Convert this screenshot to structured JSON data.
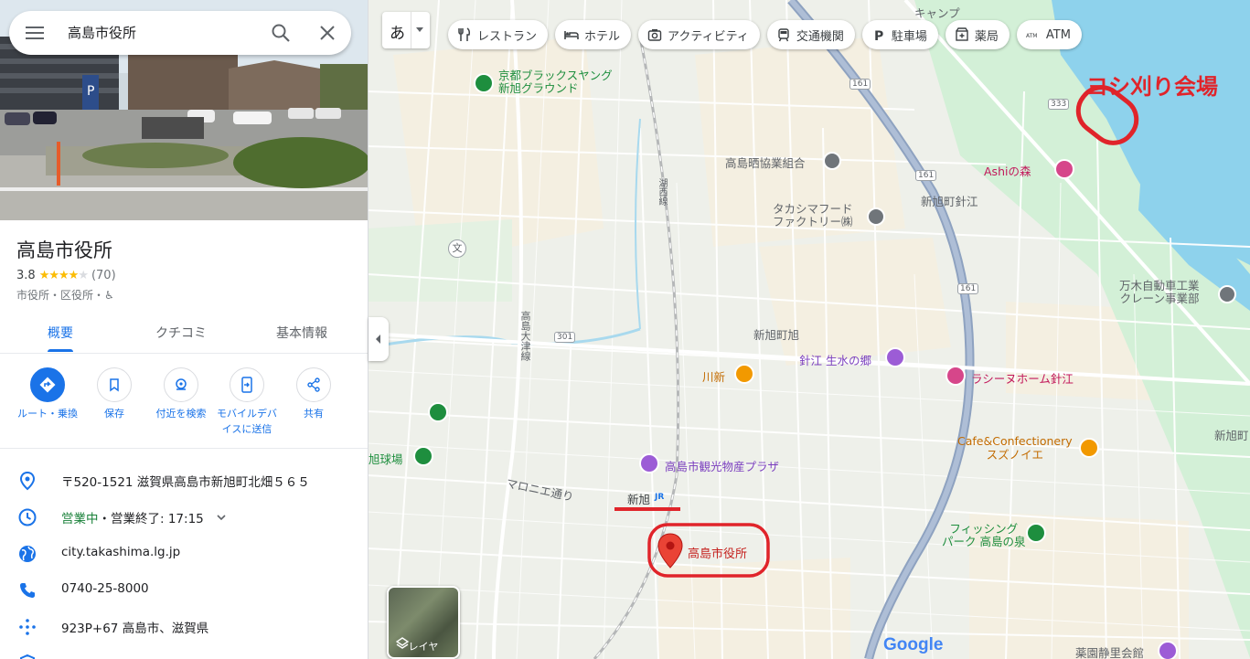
{
  "search": {
    "query": "高島市役所"
  },
  "place": {
    "name": "高島市役所",
    "rating": "3.8",
    "stars": 4,
    "review_count": "(70)",
    "category": "市役所・区役所・♿"
  },
  "tabs": [
    {
      "label": "概要",
      "active": true
    },
    {
      "label": "クチコミ",
      "active": false
    },
    {
      "label": "基本情報",
      "active": false
    }
  ],
  "actions": [
    {
      "label": "ルート・乗換",
      "icon": "directions-icon"
    },
    {
      "label": "保存",
      "icon": "bookmark-icon"
    },
    {
      "label": "付近を検索",
      "icon": "nearby-icon"
    },
    {
      "label": "モバイルデバ",
      "label2": "イスに送信",
      "icon": "send-to-phone-icon"
    },
    {
      "label": "共有",
      "icon": "share-icon"
    }
  ],
  "info": {
    "address": "〒520-1521 滋賀県高島市新旭町北畑５６５",
    "hours_open": "営業中",
    "hours_rest": "・営業終了: 17:15",
    "website": "city.takashima.lg.jp",
    "phone": "0740-25-8000",
    "pluscode": "923P+67 高島市、滋賀県"
  },
  "map": {
    "ime": "あ",
    "chips": [
      {
        "label": "レストラン",
        "icon": "restaurant-icon"
      },
      {
        "label": "ホテル",
        "icon": "hotel-icon"
      },
      {
        "label": "アクティビティ",
        "icon": "camera-icon"
      },
      {
        "label": "交通機関",
        "icon": "transit-icon"
      },
      {
        "label": "駐車場",
        "icon": "parking-icon"
      },
      {
        "label": "薬局",
        "icon": "pharmacy-icon"
      },
      {
        "label": "ATM",
        "icon": "atm-icon"
      }
    ],
    "layer_label": "レイヤ",
    "labels": {
      "kyoto_ground_1": "京都ブラックスヤング",
      "kyoto_ground_2": "新旭グラウンド",
      "sarashi": "高島晒協業組合",
      "takashima_factory_1": "タカシマフード",
      "takashima_factory_2": "ファクトリー㈱",
      "harie_area": "新旭町針江",
      "ashi_no_mori": "Ashiの森",
      "manki_1": "万木自動車工業",
      "manki_2": "クレーン事業部",
      "shinasahi_town": "新旭町旭",
      "shozu": "針江 生水の郷",
      "kawashin": "川新",
      "rashinu": "ラシーヌホーム針江",
      "cafe_1": "Cafe&Confectionery",
      "cafe_2": "スズノイエ",
      "kanko_plaza": "高島市観光物産プラザ",
      "maronie": "マロニエ通り",
      "station": "新旭",
      "cityhall_pin": "高島市役所",
      "fishing_1": "フィッシング",
      "fishing_2": "パーク 高島の泉",
      "shinasahi_right": "新旭町",
      "baseball": "旭球場",
      "yakuen": "薬園静里会館",
      "camp": "キャンプ",
      "road_301": "301",
      "road_161a": "161",
      "road_161b": "161",
      "road_161c": "161",
      "road_333": "333",
      "route_takashima": "高島大津線",
      "route_kosei": "湖西線"
    },
    "annotation": "ヨシ刈り会場",
    "google": "Google"
  },
  "colors": {
    "accent": "#1a73e8",
    "annotation": "#e0242a",
    "pin": "#ea4335",
    "water": "#8ed2ec"
  }
}
